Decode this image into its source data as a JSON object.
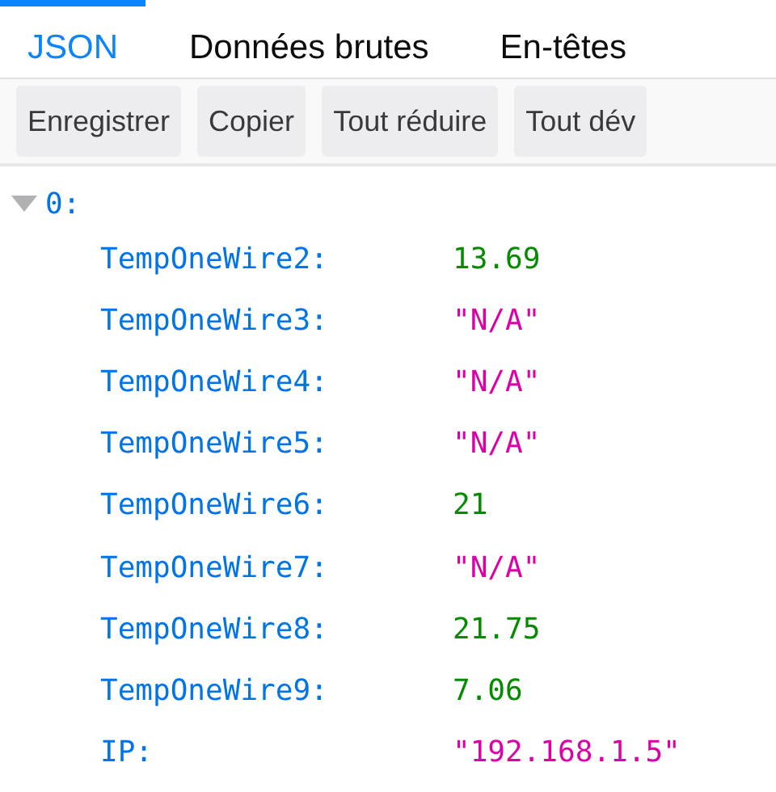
{
  "tabs": [
    {
      "label": "JSON",
      "selected": true
    },
    {
      "label": "Données brutes",
      "selected": false
    },
    {
      "label": "En-têtes",
      "selected": false
    }
  ],
  "toolbar": {
    "buttons": [
      "Enregistrer",
      "Copier",
      "Tout réduire",
      "Tout dév"
    ]
  },
  "tree": {
    "key": "0:",
    "expanded": true,
    "rows": [
      {
        "key": "TempOneWire2:",
        "value": "13.69",
        "kind": "number"
      },
      {
        "key": "TempOneWire3:",
        "value": "\"N/A\"",
        "kind": "string"
      },
      {
        "key": "TempOneWire4:",
        "value": "\"N/A\"",
        "kind": "string"
      },
      {
        "key": "TempOneWire5:",
        "value": "\"N/A\"",
        "kind": "string"
      },
      {
        "key": "TempOneWire6:",
        "value": "21",
        "kind": "number"
      },
      {
        "key": "TempOneWire7:",
        "value": "\"N/A\"",
        "kind": "string"
      },
      {
        "key": "TempOneWire8:",
        "value": "21.75",
        "kind": "number"
      },
      {
        "key": "TempOneWire9:",
        "value": "7.06",
        "kind": "number"
      },
      {
        "key": "IP:",
        "value": "\"192.168.1.5\"",
        "kind": "string"
      }
    ]
  }
}
